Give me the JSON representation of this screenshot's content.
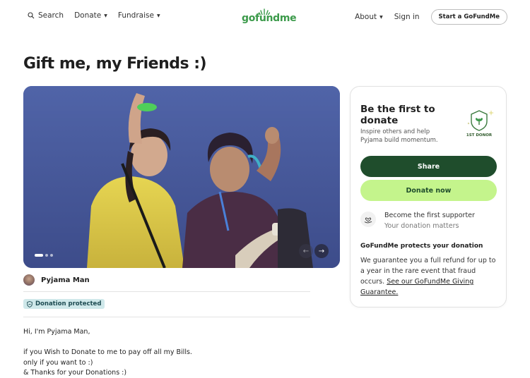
{
  "header": {
    "search_label": "Search",
    "donate_label": "Donate",
    "fundraise_label": "Fundraise",
    "logo_text": "gofundme",
    "about_label": "About",
    "signin_label": "Sign in",
    "start_label": "Start a GoFundMe"
  },
  "page": {
    "title": "Gift me, my Friends :)"
  },
  "carousel": {
    "slide_count": 3,
    "active_index": 0
  },
  "organizer": {
    "name": "Pyjama Man"
  },
  "badge": {
    "label": "Donation protected"
  },
  "story": {
    "lines": [
      "Hi, I'm Pyjama Man,",
      "",
      "if you Wish to Donate to me to pay off all my Bills.",
      "only if you want to :)",
      "& Thanks for your Donations :)"
    ]
  },
  "donate_card": {
    "title": "Be the first to donate",
    "subtitle": "Inspire others and help Pyjama build momentum.",
    "first_donor_label": "1ST DONOR",
    "share_label": "Share",
    "donate_label": "Donate now",
    "supporter_title": "Become the first supporter",
    "supporter_sub": "Your donation matters",
    "protect_title": "GoFundMe protects your donation",
    "protect_body": "We guarantee you a full refund for up to a year in the rare event that fraud occurs.",
    "protect_link": "See our GoFundMe Giving Guarantee."
  },
  "colors": {
    "brand_green": "#3b9a4a",
    "share_bg": "#1f4d2c",
    "donate_bg": "#c4f48c",
    "badge_bg": "#cfe8ea"
  }
}
